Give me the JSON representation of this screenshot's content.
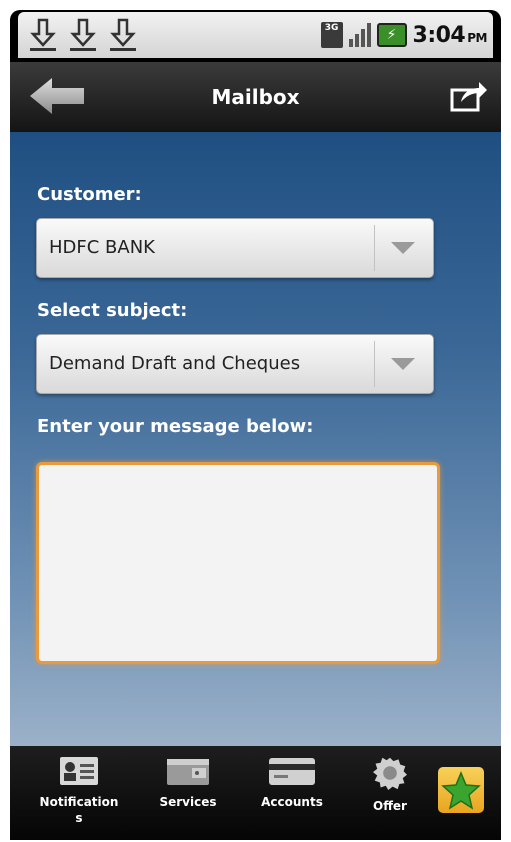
{
  "status_bar": {
    "time": "3:04",
    "ampm": "PM",
    "network": "3G",
    "download_icons": [
      "download-icon",
      "download-icon",
      "download-icon"
    ]
  },
  "header": {
    "title": "Mailbox"
  },
  "form": {
    "customer_label": "Customer:",
    "customer_value": "HDFC BANK",
    "subject_label": "Select subject:",
    "subject_value": "Demand Draft and Cheques",
    "message_label": "Enter your message below:",
    "message_value": ""
  },
  "bottom_nav": {
    "items": [
      {
        "label": "Notification\ns",
        "icon": "contact-card-icon"
      },
      {
        "label": "Services",
        "icon": "wallet-icon"
      },
      {
        "label": "Accounts",
        "icon": "credit-card-icon"
      },
      {
        "label": "Offer",
        "icon": "gear-icon"
      }
    ],
    "favorite_icon": "star-icon"
  },
  "colors": {
    "accent_orange": "#e89a3c",
    "background_blue": "#1f4f82",
    "favorite_yellow": "#f3c03f",
    "star_green": "#3aa52e"
  }
}
